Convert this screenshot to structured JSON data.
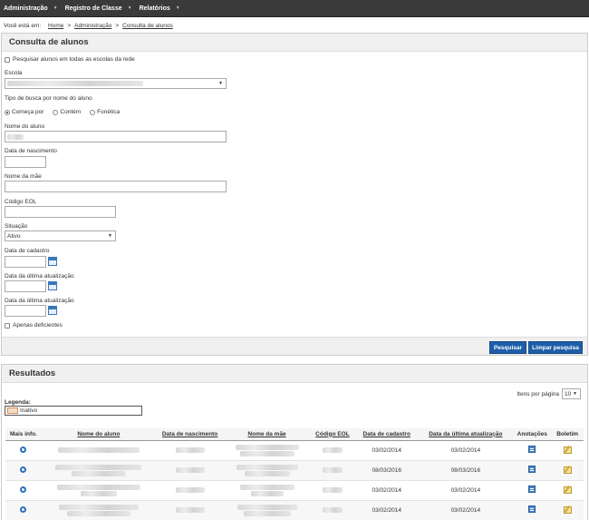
{
  "nav": {
    "items": [
      "Administração",
      "Registro de Classe",
      "Relatórios"
    ]
  },
  "breadcrumb": {
    "prefix": "Você está em:",
    "items": [
      "Home",
      "Administração",
      "Consulta de alunos"
    ],
    "separator": ">"
  },
  "search_panel": {
    "title": "Consulta de alunos",
    "search_all_label": "Pesquisar alunos em todas as escolas da rede",
    "escola_label": "Escola",
    "busca_label": "Tipo de busca por nome do aluno",
    "radio_options": [
      "Começa por",
      "Contém",
      "Fonética"
    ],
    "selected_radio": "Começa por",
    "nome_label": "Nome do aluno",
    "nascimento_label": "Data de nascimento",
    "mae_label": "Nome da mãe",
    "eol_label": "Código EOL",
    "situacao_label": "Situação",
    "situacao_value": "Ativo",
    "cadastro_label": "Data de cadastro",
    "atualizacao_label_1": "Data da última atualização",
    "atualizacao_label_2": "Data da última atualização",
    "deficientes_label": "Apenas deficientes",
    "btn_search": "Pesquisar",
    "btn_clear": "Limpar pesquisa"
  },
  "results_panel": {
    "title": "Resultados",
    "items_per_page_label": "Itens por página",
    "items_per_page_value": "10",
    "legend_title": "Legenda:",
    "legend_item": "Inativo",
    "columns": [
      "Mais info.",
      "Nome do aluno",
      "Data de nascimento",
      "Nome da mãe",
      "Código EOL",
      "Data de cadastro",
      "Data da última atualização",
      "Anotações",
      "Boletim"
    ],
    "rows": [
      {
        "cadastro": "03/02/2014",
        "atualizacao": "03/02/2014"
      },
      {
        "cadastro": "08/03/2016",
        "atualizacao": "08/03/2016"
      },
      {
        "cadastro": "03/02/2014",
        "atualizacao": "03/02/2014"
      },
      {
        "cadastro": "03/02/2014",
        "atualizacao": "03/02/2014"
      }
    ]
  },
  "colors": {
    "nav_bg": "#3a3a3a",
    "button_bg": "#1e5ea8",
    "panel_head_bg": "#f0f0f0",
    "legend_inactive": "#f2dcc8"
  }
}
